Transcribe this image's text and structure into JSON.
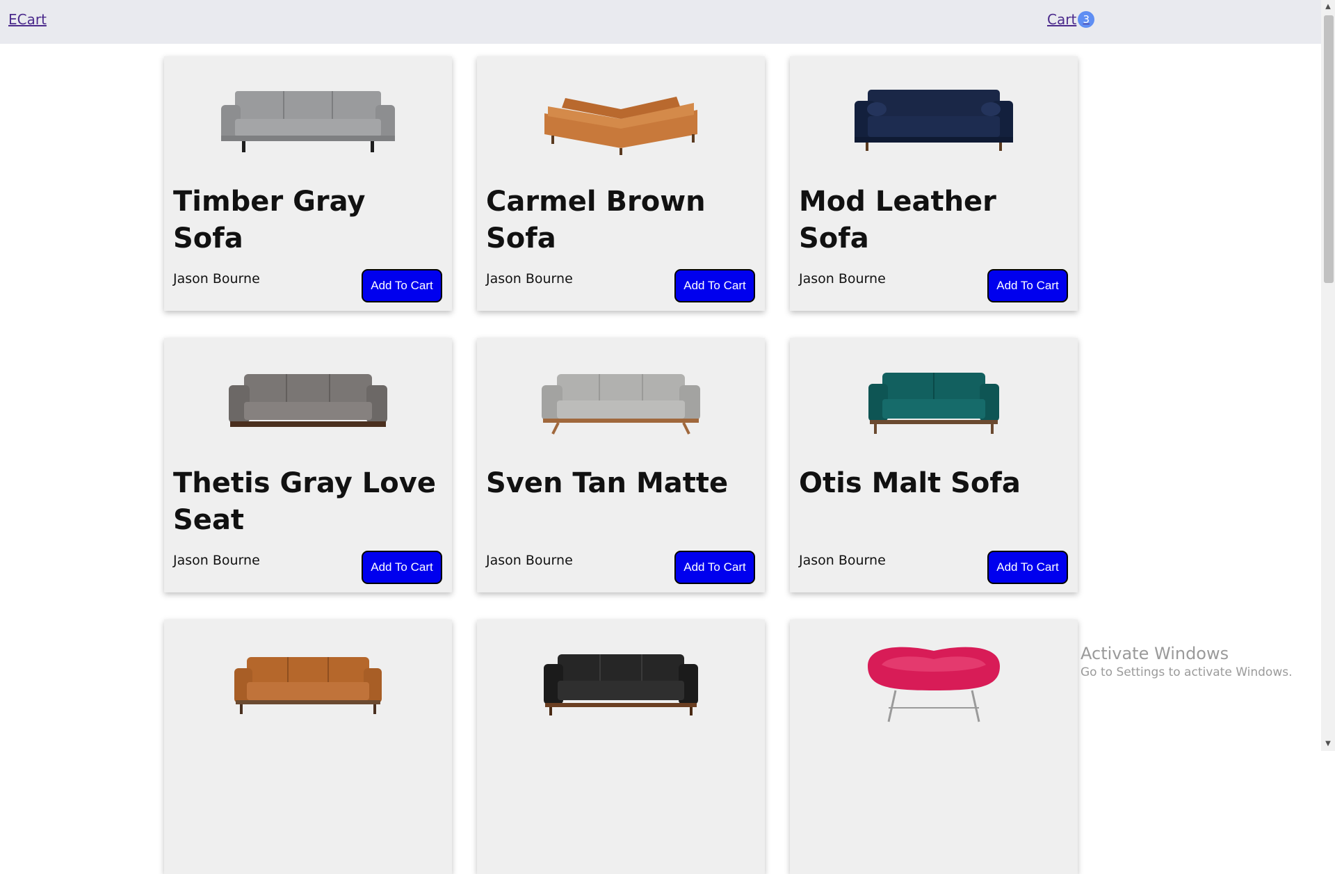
{
  "navbar": {
    "brand": "ECart",
    "cart_label": "Cart",
    "cart_count": "3"
  },
  "products": [
    {
      "title": "Timber Gray Sofa",
      "author": "Jason Bourne",
      "button": "Add To Cart",
      "image": "gray-sofa",
      "color": "#8e8f91"
    },
    {
      "title": "Carmel Brown Sofa",
      "author": "Jason Bourne",
      "button": "Add To Cart",
      "image": "brown-sectional",
      "color": "#c4773a"
    },
    {
      "title": "Mod Leather Sofa",
      "author": "Jason Bourne",
      "button": "Add To Cart",
      "image": "navy-sofa",
      "color": "#14203f"
    },
    {
      "title": "Thetis Gray Love Seat",
      "author": "Jason Bourne",
      "button": "Add To Cart",
      "image": "gray-loveseat",
      "color": "#6f6b69"
    },
    {
      "title": "Sven Tan Matte",
      "author": "Jason Bourne",
      "button": "Add To Cart",
      "image": "light-gray-sofa",
      "color": "#a9a9a7"
    },
    {
      "title": "Otis Malt Sofa",
      "author": "Jason Bourne",
      "button": "Add To Cart",
      "image": "teal-loveseat",
      "color": "#0f5a5a"
    },
    {
      "title": "",
      "author": "",
      "button": "",
      "image": "tan-leather-sofa",
      "color": "#b5672b"
    },
    {
      "title": "",
      "author": "",
      "button": "",
      "image": "black-leather-sofa",
      "color": "#1f1f1f"
    },
    {
      "title": "",
      "author": "",
      "button": "",
      "image": "pink-egg-sofa",
      "color": "#d81c57"
    }
  ],
  "watermark": {
    "title": "Activate Windows",
    "subtitle": "Go to Settings to activate Windows."
  },
  "colors": {
    "navbar_bg": "#e9eaef",
    "button_bg": "#0000ee",
    "badge_bg": "#5f8ef3",
    "card_bg": "#efefef"
  }
}
